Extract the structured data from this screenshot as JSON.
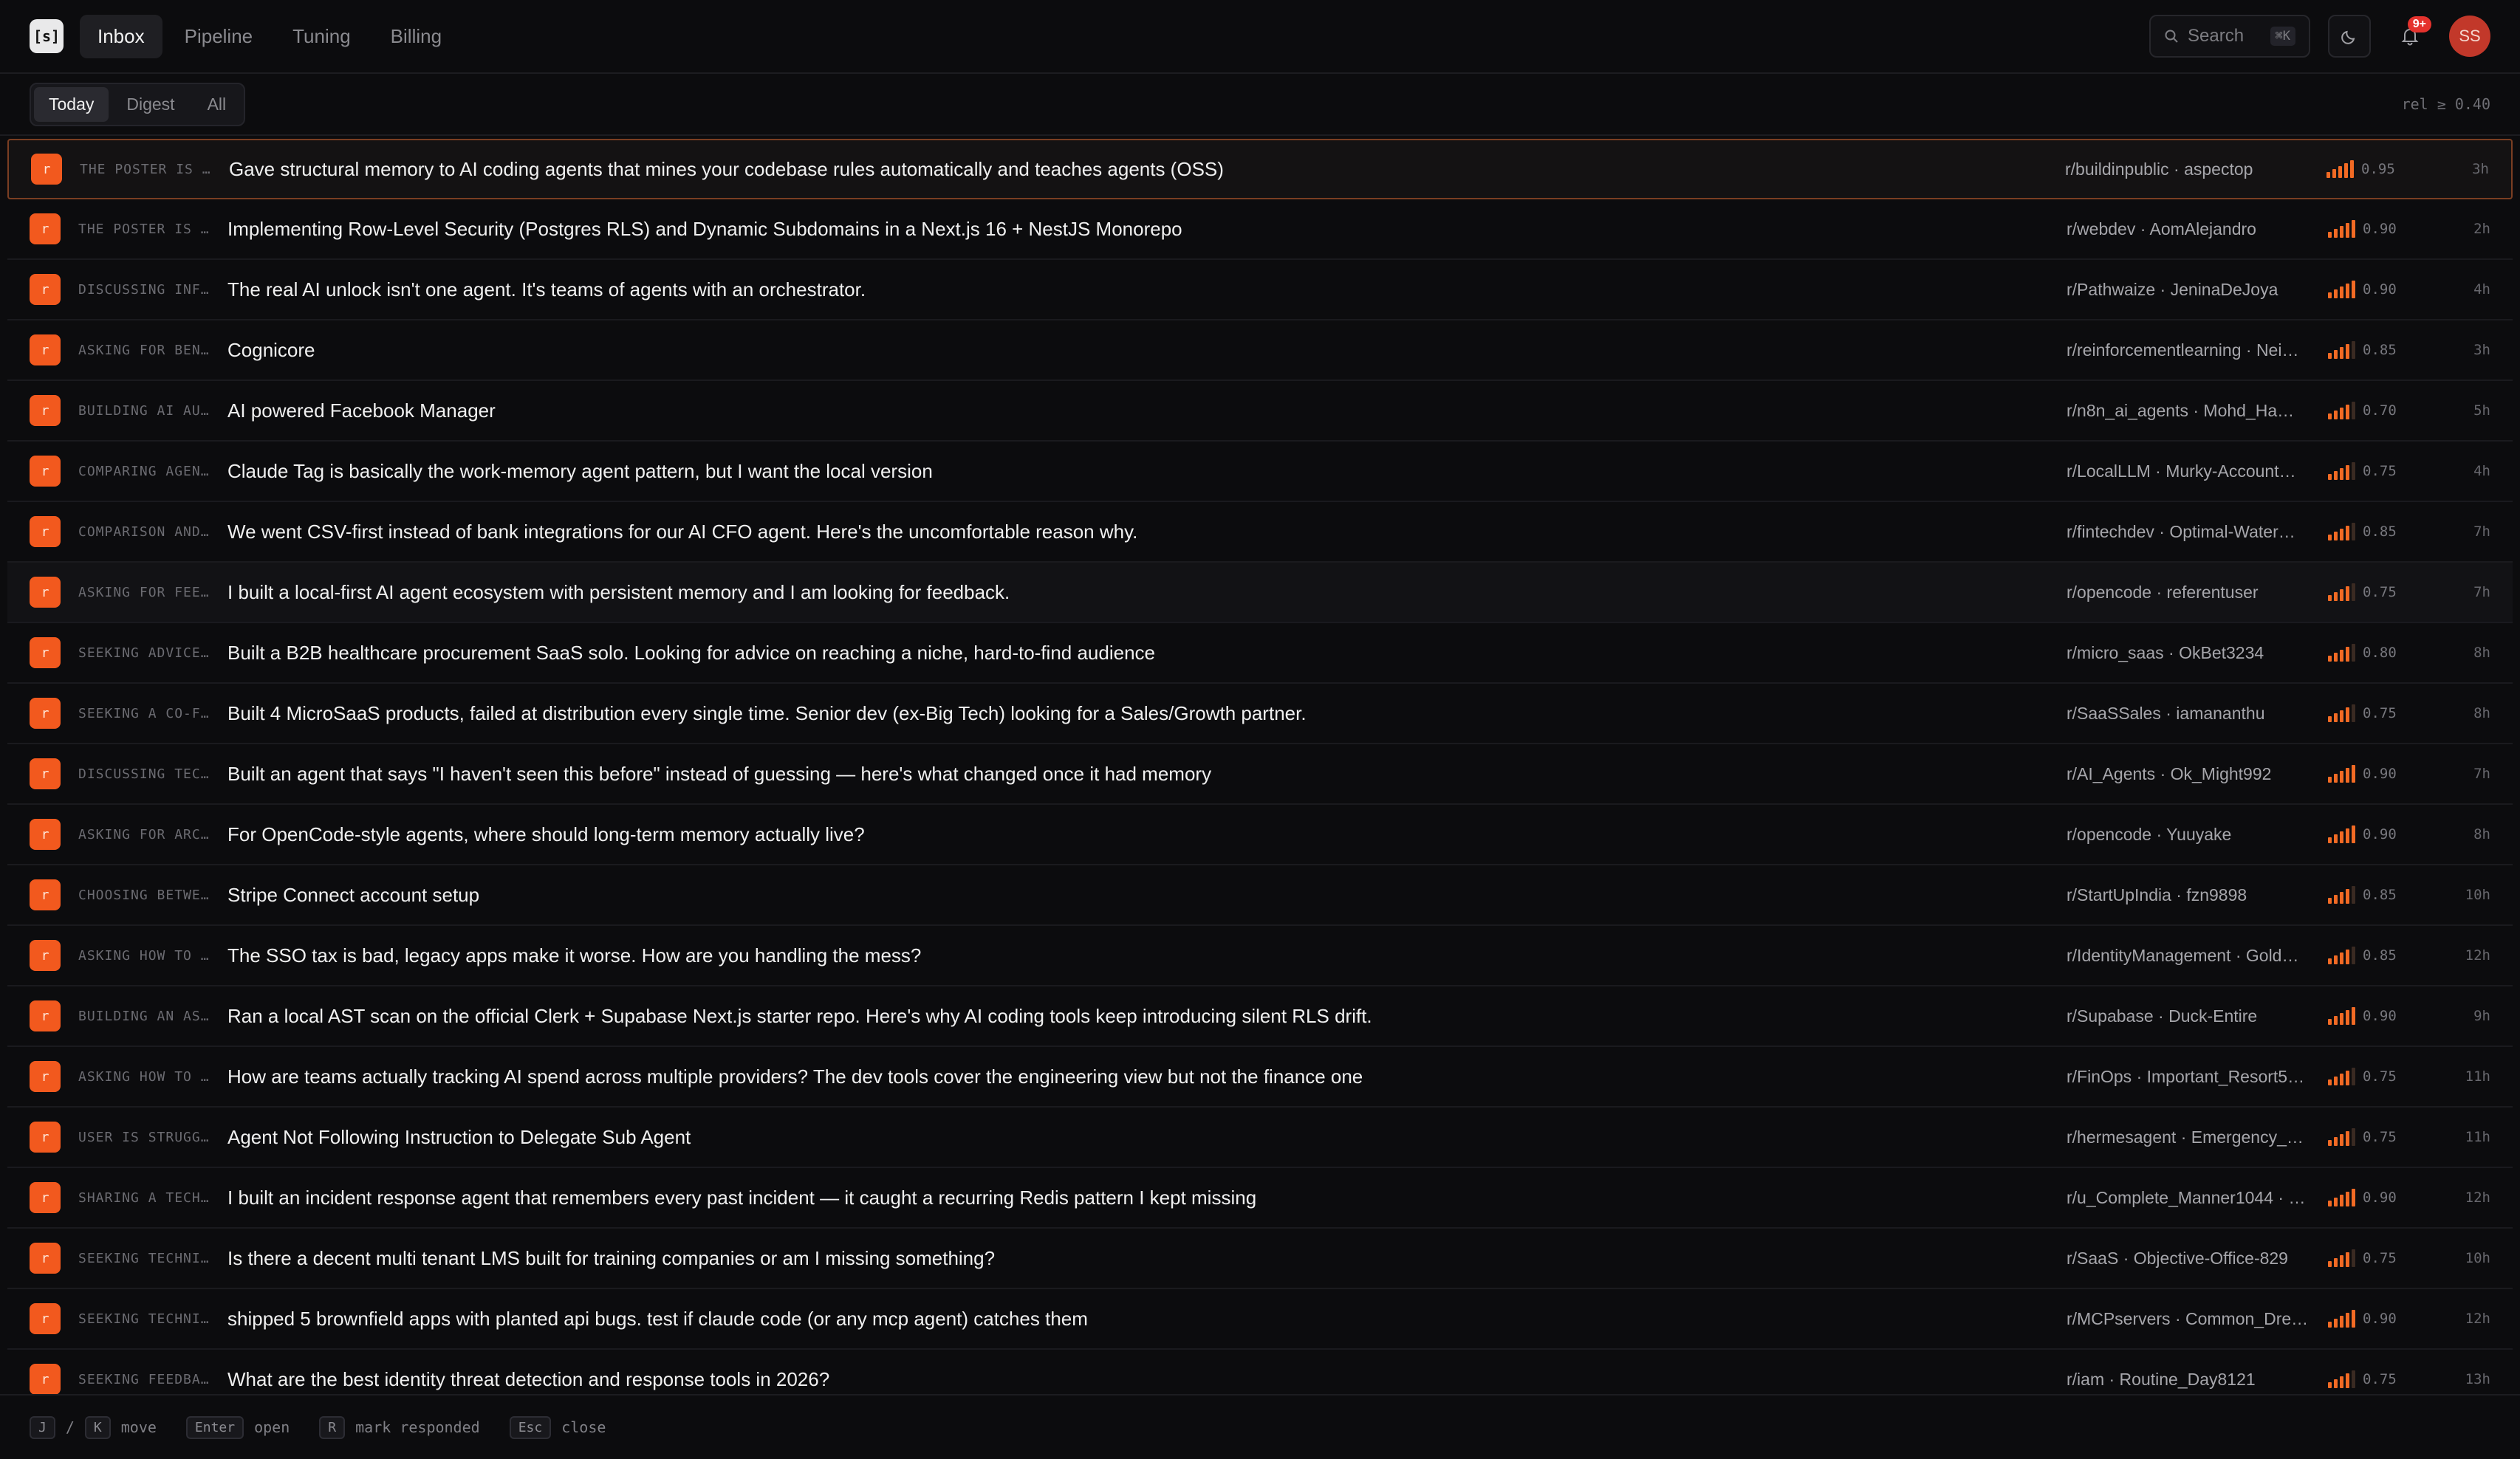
{
  "app": {
    "logo": "[s]",
    "nav": [
      "Inbox",
      "Pipeline",
      "Tuning",
      "Billing"
    ],
    "active_nav": "Inbox",
    "search_label": "Search",
    "search_shortcut": "⌘K",
    "notification_badge": "9+",
    "avatar_initials": "SS"
  },
  "filters": {
    "tabs": [
      "Today",
      "Digest",
      "All"
    ],
    "active_tab": "Today",
    "relevance": "rel ≥ 0.40"
  },
  "posts": [
    {
      "tag": "THE POSTER IS …",
      "title": "Gave structural memory to AI coding agents that mines your codebase rules automatically and teaches agents (OSS)",
      "sub": "r/buildinpublic · aspectop",
      "score": "0.95",
      "age": "3h"
    },
    {
      "tag": "THE POSTER IS …",
      "title": "Implementing Row-Level Security (Postgres RLS) and Dynamic Subdomains in a Next.js 16 + NestJS Monorepo",
      "sub": "r/webdev · AomAlejandro",
      "score": "0.90",
      "age": "2h"
    },
    {
      "tag": "DISCUSSING INF…",
      "title": "The real AI unlock isn't one agent. It's teams of agents with an orchestrator.",
      "sub": "r/Pathwaize · JeninaDeJoya",
      "score": "0.90",
      "age": "4h"
    },
    {
      "tag": "ASKING FOR BEN…",
      "title": "Cognicore",
      "sub": "r/reinforcementlearning · Nei…",
      "score": "0.85",
      "age": "3h"
    },
    {
      "tag": "BUILDING AI AU…",
      "title": "AI powered Facebook Manager",
      "sub": "r/n8n_ai_agents · Mohd_Ha…",
      "score": "0.70",
      "age": "5h"
    },
    {
      "tag": "COMPARING AGEN…",
      "title": "Claude Tag is basically the work-memory agent pattern, but I want the local version",
      "sub": "r/LocalLLM · Murky-Account…",
      "score": "0.75",
      "age": "4h"
    },
    {
      "tag": "COMPARISON AND…",
      "title": "We went CSV-first instead of bank integrations for our AI CFO agent. Here's the uncomfortable reason why.",
      "sub": "r/fintechdev · Optimal-Water…",
      "score": "0.85",
      "age": "7h"
    },
    {
      "tag": "ASKING FOR FEE…",
      "title": "I built a local-first AI agent ecosystem with persistent memory and I am looking for feedback.",
      "sub": "r/opencode · referentuser",
      "score": "0.75",
      "age": "7h"
    },
    {
      "tag": "SEEKING ADVICE…",
      "title": "Built a B2B healthcare procurement SaaS solo. Looking for advice on reaching a niche, hard-to-find audience",
      "sub": "r/micro_saas · OkBet3234",
      "score": "0.80",
      "age": "8h"
    },
    {
      "tag": "SEEKING A CO-F…",
      "title": "Built 4 MicroSaaS products, failed at distribution every single time. Senior dev (ex-Big Tech) looking for a Sales/Growth partner.",
      "sub": "r/SaaSSales · iamananthu",
      "score": "0.75",
      "age": "8h"
    },
    {
      "tag": "DISCUSSING TEC…",
      "title": "Built an agent that says \"I haven't seen this before\" instead of guessing — here's what changed once it had memory",
      "sub": "r/AI_Agents · Ok_Might992",
      "score": "0.90",
      "age": "7h"
    },
    {
      "tag": "ASKING FOR ARC…",
      "title": "For OpenCode-style agents, where should long-term memory actually live?",
      "sub": "r/opencode · Yuuyake",
      "score": "0.90",
      "age": "8h"
    },
    {
      "tag": "CHOOSING BETWE…",
      "title": "Stripe Connect account setup",
      "sub": "r/StartUpIndia · fzn9898",
      "score": "0.85",
      "age": "10h"
    },
    {
      "tag": "ASKING HOW TO …",
      "title": "The SSO tax is bad, legacy apps make it worse. How are you handling the mess?",
      "sub": "r/IdentityManagement · Gold…",
      "score": "0.85",
      "age": "12h"
    },
    {
      "tag": "BUILDING AN AS…",
      "title": "Ran a local AST scan on the official Clerk + Supabase Next.js starter repo. Here's why AI coding tools keep introducing silent RLS drift.",
      "sub": "r/Supabase · Duck-Entire",
      "score": "0.90",
      "age": "9h"
    },
    {
      "tag": "ASKING HOW TO …",
      "title": "How are teams actually tracking AI spend across multiple providers? The dev tools cover the engineering view but not the finance one",
      "sub": "r/FinOps · Important_Resort5…",
      "score": "0.75",
      "age": "11h"
    },
    {
      "tag": "USER IS STRUGG…",
      "title": "Agent Not Following Instruction to Delegate Sub Agent",
      "sub": "r/hermesagent · Emergency_…",
      "score": "0.75",
      "age": "11h"
    },
    {
      "tag": "SHARING A TECH…",
      "title": "I built an incident response agent that remembers every past incident — it caught a recurring Redis pattern I kept missing",
      "sub": "r/u_Complete_Manner1044 · …",
      "score": "0.90",
      "age": "12h"
    },
    {
      "tag": "SEEKING TECHNI…",
      "title": "Is there a decent multi tenant LMS built for training companies or am I missing something?",
      "sub": "r/SaaS · Objective-Office-829",
      "score": "0.75",
      "age": "10h"
    },
    {
      "tag": "SEEKING TECHNI…",
      "title": "shipped 5 brownfield apps with planted api bugs. test if claude code (or any mcp agent) catches them",
      "sub": "r/MCPservers · Common_Dre…",
      "score": "0.90",
      "age": "12h"
    },
    {
      "tag": "SEEKING FEEDBA…",
      "title": "What are the best identity threat detection and response tools in 2026?",
      "sub": "r/iam · Routine_Day8121",
      "score": "0.75",
      "age": "13h"
    }
  ],
  "source_glyph": "r",
  "shortcuts": [
    {
      "keys": [
        "J",
        "K"
      ],
      "sep": "/",
      "label": "move"
    },
    {
      "keys": [
        "Enter"
      ],
      "label": "open"
    },
    {
      "keys": [
        "R"
      ],
      "label": "mark responded"
    },
    {
      "keys": [
        "Esc"
      ],
      "label": "close"
    }
  ],
  "colors": {
    "accent": "#f26a24",
    "background": "#0c0c0e",
    "selected_border": "#7a3e22"
  }
}
